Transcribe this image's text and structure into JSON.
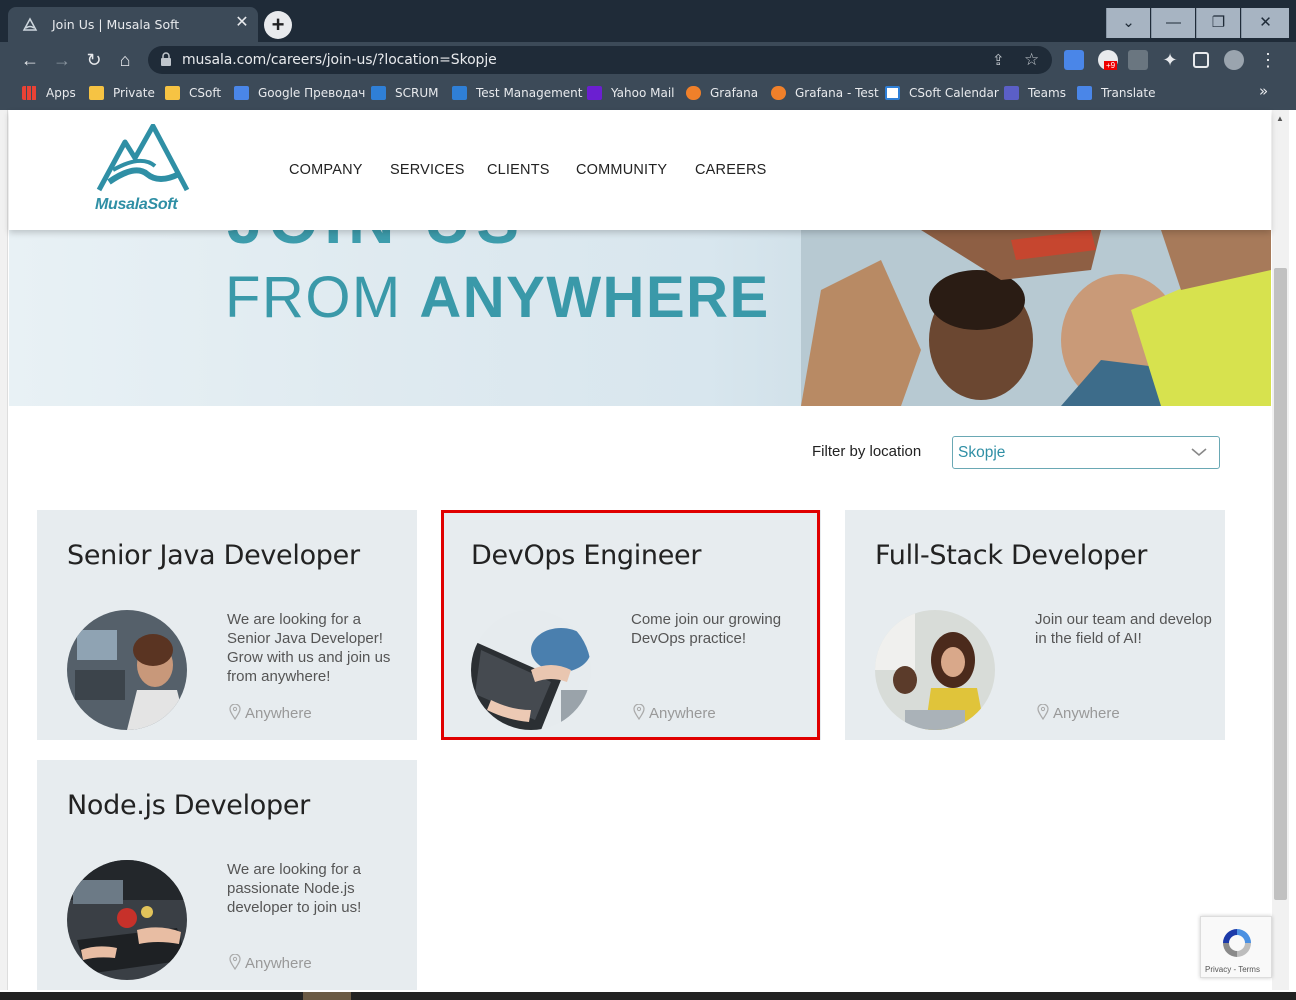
{
  "browser": {
    "tab_title": "Join Us | Musala Soft",
    "url": "musala.com/careers/join-us/?location=Skopje",
    "bookmarks": [
      {
        "label": "Apps",
        "color": "#e94235"
      },
      {
        "label": "Private",
        "color": "#f6c343"
      },
      {
        "label": "CSoft",
        "color": "#f6c343"
      },
      {
        "label": "Google Преводач",
        "color": "#4a86e8"
      },
      {
        "label": "SCRUM",
        "color": "#2f7fd6"
      },
      {
        "label": "Test Management",
        "color": "#2f7fd6"
      },
      {
        "label": "Yahoo Mail",
        "color": "#6b1fd1"
      },
      {
        "label": "Grafana",
        "color": "#f0802a"
      },
      {
        "label": "Grafana - Test",
        "color": "#f0802a"
      },
      {
        "label": "CSoft Calendar",
        "color": "#ffffff"
      },
      {
        "label": "Teams",
        "color": "#5b5fc7"
      },
      {
        "label": "Translate",
        "color": "#4a86e8"
      }
    ],
    "more_bookmarks": "»",
    "ext_badge": "+9"
  },
  "site": {
    "brand": "MusalaSoft",
    "nav": [
      "COMPANY",
      "SERVICES",
      "CLIENTS",
      "COMMUNITY",
      "CAREERS"
    ],
    "hero_top": "JOIN US",
    "hero_line2_pre": "FROM ",
    "hero_line2_bold": "ANYWHERE"
  },
  "filter": {
    "label": "Filter by location",
    "value": "Skopje"
  },
  "jobs": [
    {
      "title": "Senior Java Developer",
      "description": "We are looking for a Senior Java Developer! Grow with us and join us from anywhere!",
      "location": "Anywhere"
    },
    {
      "title": "DevOps Engineer",
      "description": "Come join our growing DevOps practice!",
      "location": "Anywhere"
    },
    {
      "title": "Full-Stack Developer",
      "description": "Join our team and develop in the field of AI!",
      "location": "Anywhere"
    },
    {
      "title": "Node.js Developer",
      "description": "We are looking for a passionate Node.js developer to join us!",
      "location": "Anywhere"
    }
  ],
  "recaptcha": {
    "text": "Privacy - Terms"
  },
  "colors": {
    "accent": "#2f8fa5",
    "highlight": "#e00000",
    "card_bg": "#e7ecef"
  }
}
